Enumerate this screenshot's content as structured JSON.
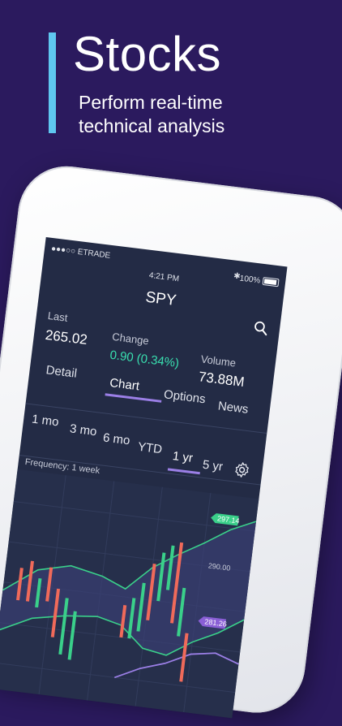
{
  "promo": {
    "title": "Stocks",
    "subtitle_line1": "Perform real-time",
    "subtitle_line2": "technical analysis"
  },
  "status_bar": {
    "carrier": "●●●○○ ETRADE",
    "time": "4:21 PM",
    "battery": "100%"
  },
  "header": {
    "ticker": "SPY",
    "search_icon": "search-icon"
  },
  "quote": {
    "last_label": "Last",
    "last_value": "265.02",
    "change_label": "Change",
    "change_value": "0.90 (0.34%)",
    "volume_label": "Volume",
    "volume_value": "73.88M"
  },
  "tabs": [
    {
      "label": "Detail"
    },
    {
      "label": "Chart",
      "active": true
    },
    {
      "label": "Options"
    },
    {
      "label": "News"
    }
  ],
  "ranges": [
    {
      "label": "1 mo"
    },
    {
      "label": "3 mo"
    },
    {
      "label": "6 mo"
    },
    {
      "label": "YTD"
    },
    {
      "label": "1 yr",
      "active": true
    },
    {
      "label": "5 yr"
    }
  ],
  "chart": {
    "frequency": "Frequency: 1 week",
    "price_tag_top": "297.14",
    "price_tag_bottom": "281.26",
    "y_tick": "290.00",
    "colors": {
      "up": "#3ad08a",
      "down": "#f06a5a",
      "band": "#3ad08a",
      "ma": "#9b7fe6",
      "tag_top": "#3ad08a",
      "tag_bottom": "#8a5fd6"
    }
  },
  "colors": {
    "background": "#2b1a5e",
    "accent": "#5fc7f0",
    "screen": "#232b45"
  }
}
